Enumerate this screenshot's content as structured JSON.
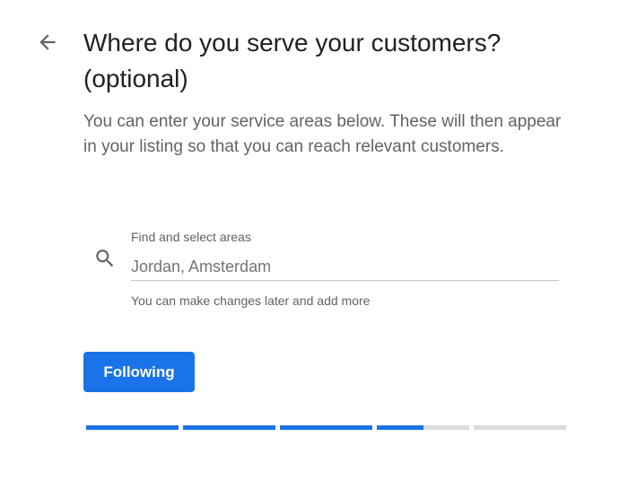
{
  "header": {
    "back_icon": "arrow-back-icon",
    "title_line1": "Where do you serve your customers?",
    "title_line2": "(optional)"
  },
  "main": {
    "description": "You can enter your service areas below. These will then appear in your listing so that you can reach relevant customers.",
    "search": {
      "icon": "search-icon",
      "label": "Find and select areas",
      "value": "",
      "placeholder": "Jordan, Amsterdam",
      "helper": "You can make changes later and add more"
    },
    "next_label": "Following"
  },
  "progress": {
    "segments": [
      1,
      1,
      1,
      0.5,
      0
    ]
  },
  "colors": {
    "accent": "#1a73e8",
    "track": "#dadce0",
    "title": "#202124",
    "secondary_text": "#5f6368"
  }
}
